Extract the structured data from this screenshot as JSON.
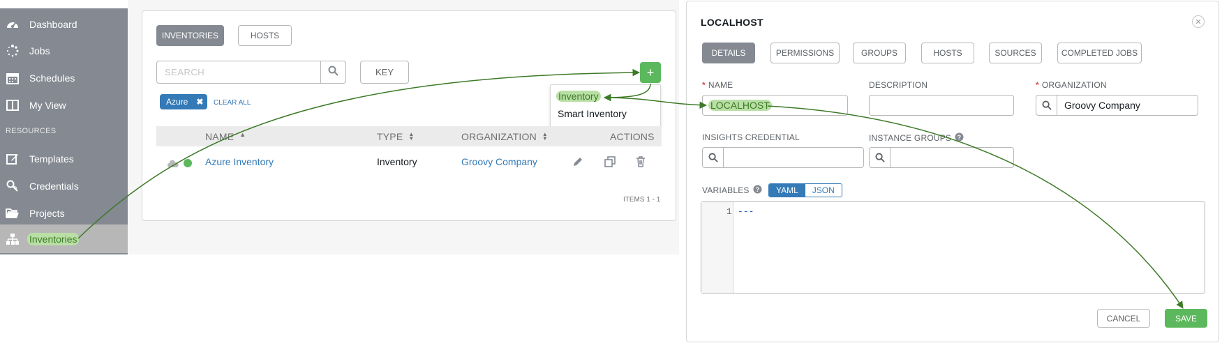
{
  "sidebar": {
    "items": [
      {
        "label": "Dashboard",
        "icon": "dashboard-icon"
      },
      {
        "label": "Jobs",
        "icon": "spinner-icon"
      },
      {
        "label": "Schedules",
        "icon": "calendar-icon"
      },
      {
        "label": "My View",
        "icon": "columns-icon"
      },
      {
        "label": "Templates",
        "icon": "edit-icon"
      },
      {
        "label": "Credentials",
        "icon": "key-icon"
      },
      {
        "label": "Projects",
        "icon": "folder-icon"
      },
      {
        "label": "Inventories",
        "icon": "sitemap-icon"
      }
    ],
    "resources_heading": "RESOURCES"
  },
  "inventory_list": {
    "tabs": [
      "INVENTORIES",
      "HOSTS"
    ],
    "search_placeholder": "SEARCH",
    "key_label": "KEY",
    "filter_chip": "Azure",
    "clear_all": "CLEAR ALL",
    "add_label": "+",
    "dropdown": [
      "Inventory",
      "Smart Inventory"
    ],
    "columns": [
      "NAME",
      "TYPE",
      "ORGANIZATION",
      "ACTIONS"
    ],
    "rows": [
      {
        "name": "Azure Inventory",
        "type": "Inventory",
        "organization": "Groovy Company"
      }
    ],
    "items_count": "ITEMS  1 - 1"
  },
  "detail": {
    "title": "LOCALHOST",
    "tabs": [
      "DETAILS",
      "PERMISSIONS",
      "GROUPS",
      "HOSTS",
      "SOURCES",
      "COMPLETED JOBS"
    ],
    "fields": {
      "name_label": "NAME",
      "name_value": "LOCALHOST",
      "description_label": "DESCRIPTION",
      "organization_label": "ORGANIZATION",
      "organization_value": "Groovy Company",
      "insights_label": "INSIGHTS CREDENTIAL",
      "instance_groups_label": "INSTANCE GROUPS",
      "variables_label": "VARIABLES"
    },
    "format_toggle": [
      "YAML",
      "JSON"
    ],
    "code_line_number": "1",
    "code_text": "---",
    "cancel_label": "CANCEL",
    "save_label": "SAVE"
  },
  "colors": {
    "sidebar_bg": "#848992",
    "active_bg": "#b7b7b7",
    "primary": "#337ab7",
    "success": "#5cb85c",
    "highlight": "#b9dfa5",
    "arrow": "#3d7a28"
  }
}
